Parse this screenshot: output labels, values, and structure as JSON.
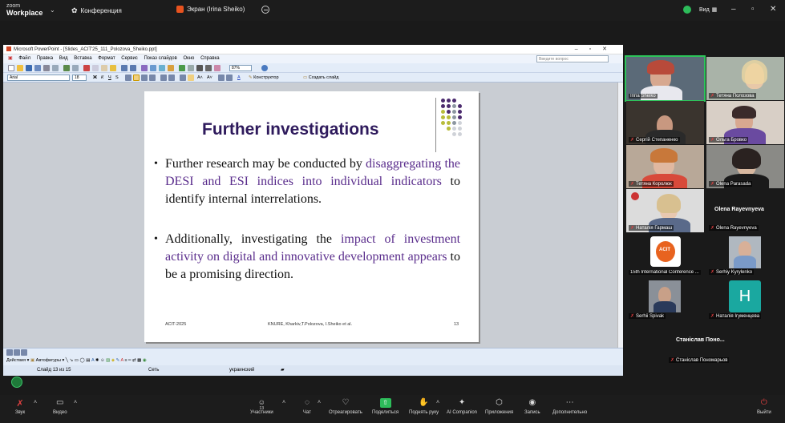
{
  "zoom": {
    "brand_line1": "zoom",
    "brand_line2": "Workplace",
    "meeting_label": "Конференция",
    "share_label": "Экран (Irina Sheiko)",
    "view_label": "Вид"
  },
  "ppt": {
    "window_title": "Microsoft PowerPoint - [Slides_ACIT'25_111_Polozova_Sheiko.ppt]",
    "menu": [
      "Файл",
      "Правка",
      "Вид",
      "Вставка",
      "Формат",
      "Сервис",
      "Показ слайдов",
      "Окно",
      "Справка"
    ],
    "ask_placeholder": "Введите вопрос",
    "font_name": "Arial",
    "font_size": "18",
    "zoom": "87%",
    "designer_label": "Конструктор",
    "new_slide_label": "Создать слайд",
    "draw_label": "Действия",
    "autoshapes_label": "Автофигуры",
    "status_slide": "Слайд 13 из 15",
    "status_design": "Сеть",
    "status_lang": "украинский"
  },
  "slide": {
    "title": "Further investigations",
    "bullet1_plain1": "Further research may be conducted by",
    "bullet1_hl": "disaggregating the DESI and ESI indices into individual indicators",
    "bullet1_plain2": "to identify internal interrelations.",
    "bullet2_plain1": "Additionally, investigating the",
    "bullet2_hl": "impact of investment activity on digital and innovative development appears",
    "bullet2_plain2": "to be a promising direction.",
    "footer_left": "ACIT-2025",
    "footer_center": "KNURE, Kharkiv,T.Polozova, I.Sheiko et al.",
    "footer_page": "13",
    "colors": {
      "title": "#2e1a5c",
      "highlight": "#5a2d8c",
      "dot_purple": "#4b2a6e",
      "dot_olive": "#b8bc3a",
      "dot_grey": "#8c96a0",
      "dot_light": "#cfd2d8"
    }
  },
  "participants": [
    {
      "name": "Irina Sheiko",
      "active": true
    },
    {
      "name": "Тетяна Полозова"
    },
    {
      "name": "Сергій Степаненко"
    },
    {
      "name": "Ольга Бровко"
    },
    {
      "name": "Тетяна Королюк"
    },
    {
      "name": "Olena Parasada"
    },
    {
      "name": "Наталія Гармаш"
    },
    {
      "name": "Olena Rayevnyeva",
      "big": "Olena Rayevnyeva"
    },
    {
      "name": "15th International Conference ...",
      "logo": "ACIT"
    },
    {
      "name": "Serhiy Kyrylenko"
    },
    {
      "name": "Serhii Spivak"
    },
    {
      "name": "Наталія Ігуменцева",
      "letter": "H"
    },
    {
      "name": "Станіслав Пономарьов",
      "big": "Станіслав Поно..."
    }
  ],
  "controls": {
    "audio": "Звук",
    "video": "Видео",
    "participants": "Участники",
    "participants_count": "13",
    "chat": "Чат",
    "react": "Отреагировать",
    "share": "Поделиться",
    "raise": "Поднять руку",
    "companion": "AI Companion",
    "apps": "Приложения",
    "record": "Запись",
    "more": "Дополнительно",
    "leave": "Выйти"
  }
}
